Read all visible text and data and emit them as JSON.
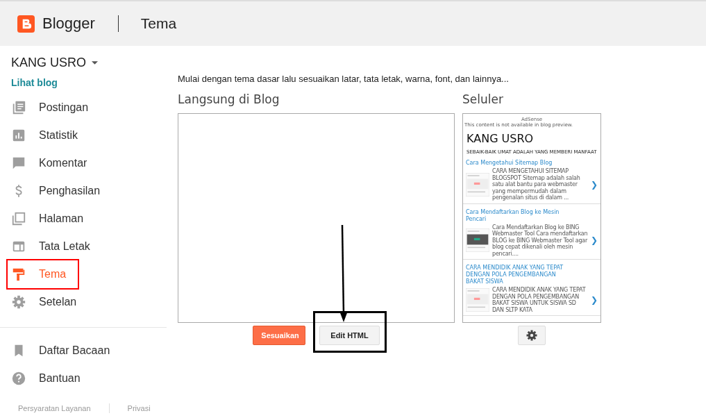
{
  "header": {
    "brand": "Blogger",
    "page_title": "Tema"
  },
  "sidebar": {
    "blog_name": "KANG USRO",
    "view_link": "Lihat blog",
    "items": [
      {
        "label": "Postingan",
        "selected": false,
        "highlighted": false
      },
      {
        "label": "Statistik",
        "selected": false,
        "highlighted": false
      },
      {
        "label": "Komentar",
        "selected": false,
        "highlighted": false
      },
      {
        "label": "Penghasilan",
        "selected": false,
        "highlighted": false
      },
      {
        "label": "Halaman",
        "selected": false,
        "highlighted": false
      },
      {
        "label": "Tata Letak",
        "selected": false,
        "highlighted": false
      },
      {
        "label": "Tema",
        "selected": true,
        "highlighted": true
      },
      {
        "label": "Setelan",
        "selected": false,
        "highlighted": false
      }
    ],
    "secondary_items": [
      {
        "label": "Daftar Bacaan"
      },
      {
        "label": "Bantuan"
      }
    ],
    "footer_links": [
      "Persyaratan Layanan",
      "Privasi"
    ]
  },
  "main": {
    "intro": "Mulai dengan tema dasar lalu sesuaikan latar, tata letak, warna, font, dan lainnya...",
    "live_heading": "Langsung di Blog",
    "mobile_heading": "Seluler",
    "buttons": [
      {
        "label": "Sesuaikan",
        "kind": "primary",
        "annotated": false
      },
      {
        "label": "Edit HTML",
        "kind": "secondary",
        "annotated": true
      }
    ],
    "mobile_preview": {
      "ad_label": "AdSense",
      "notice": "This content is not available in blog preview.",
      "blog_title": "KANG USRO",
      "tagline": "SEBAIK-BAIK UMAT ADALAH YANG MEMBERI MANFAAT",
      "posts": [
        {
          "title": "Cara Mengetahui Sitemap Blog",
          "excerpt": "CARA MENGETAHUI SITEMAP BLOGSPOT Sitemap adalah salah satu alat bantu para webmaster yang mempermudah dalam pengenalan situs di dalam ...",
          "chevron": "❯"
        },
        {
          "title": "Cara Mendaftarkan Blog ke Mesin Pencari",
          "excerpt": "Cara Mendaftarkan Blog ke BING Webmaster Tool Cara mendaftarkan BLOG ke BING Webmaster Tool agar blog cepat dikenali oleh mesin pencari....",
          "chevron": "❯"
        },
        {
          "title": "CARA MENDIDIK ANAK YANG TEPAT DENGAN POLA PENGEMBANGAN BAKAT SISWA",
          "excerpt": "CARA MENDIDIK ANAK YANG TEPAT DENGAN POLA PENGEMBANGAN BAKAT SISWA UNTUK SISWA SD DAN SLTP KATA",
          "chevron": "❯"
        }
      ]
    }
  }
}
